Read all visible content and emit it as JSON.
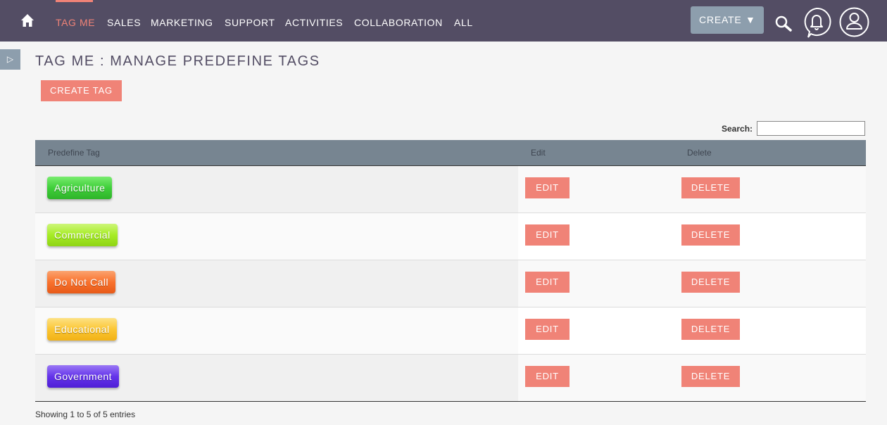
{
  "nav": {
    "items": [
      {
        "label": "TAG ME",
        "active": true
      },
      {
        "label": "SALES"
      },
      {
        "label": "MARKETING"
      },
      {
        "label": "SUPPORT"
      },
      {
        "label": "ACTIVITIES"
      },
      {
        "label": "COLLABORATION"
      },
      {
        "label": "ALL"
      }
    ],
    "create_label": "CREATE",
    "caret": "▼",
    "icons": [
      "home-icon",
      "search-icon",
      "bell-icon",
      "user-icon"
    ]
  },
  "sidebar": {
    "toggle_glyph": "▷"
  },
  "page": {
    "title": "TAG ME : MANAGE PREDEFINE TAGS",
    "create_tag_label": "CREATE TAG"
  },
  "search": {
    "label": "Search:",
    "value": ""
  },
  "table": {
    "headers": {
      "tag": "Predefine Tag",
      "edit": "Edit",
      "delete": "Delete"
    },
    "rows": [
      {
        "tag": "Agriculture",
        "edit": "EDIT",
        "delete": "DELETE"
      },
      {
        "tag": "Commercial",
        "edit": "EDIT",
        "delete": "DELETE"
      },
      {
        "tag": "Do Not Call",
        "edit": "EDIT",
        "delete": "DELETE"
      },
      {
        "tag": "Educational",
        "edit": "EDIT",
        "delete": "DELETE"
      },
      {
        "tag": "Government",
        "edit": "EDIT",
        "delete": "DELETE"
      }
    ]
  },
  "footer": {
    "info": "Showing 1 to 5 of 5 entries"
  },
  "colors": {
    "nav_bg": "#534d64",
    "accent": "#f08377",
    "create_btn": "#8d9ead",
    "header_bg": "#778591",
    "tag_agriculture": "#3fcf3a",
    "tag_commercial": "#a6ec25",
    "tag_do_not_call": "#f9722e",
    "tag_educational": "#fbc634",
    "tag_government": "#6434ea"
  }
}
